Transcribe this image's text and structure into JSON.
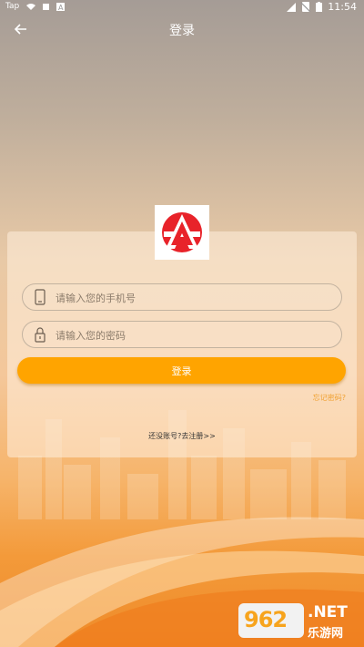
{
  "status_bar": {
    "carrier": "Tap",
    "time": "11:54",
    "icons": [
      "wifi-icon",
      "square-icon",
      "a-icon",
      "signal-icon",
      "no-sim-icon",
      "battery-icon"
    ]
  },
  "header": {
    "title": "登录",
    "back_icon": "arrow-left-icon"
  },
  "logo": {
    "description": "app-logo",
    "colors": [
      "#e8232a",
      "#ffffff"
    ]
  },
  "form": {
    "phone_placeholder": "请输入您的手机号",
    "password_placeholder": "请输入您的密码",
    "login_label": "登录",
    "forgot_label": "忘记密码?",
    "register_label": "还没账号?去注册>>"
  },
  "watermark": {
    "number": "962",
    "suffix": ".NET",
    "site": "乐游网"
  },
  "colors": {
    "accent": "#ffa400",
    "link": "#f0a030"
  }
}
